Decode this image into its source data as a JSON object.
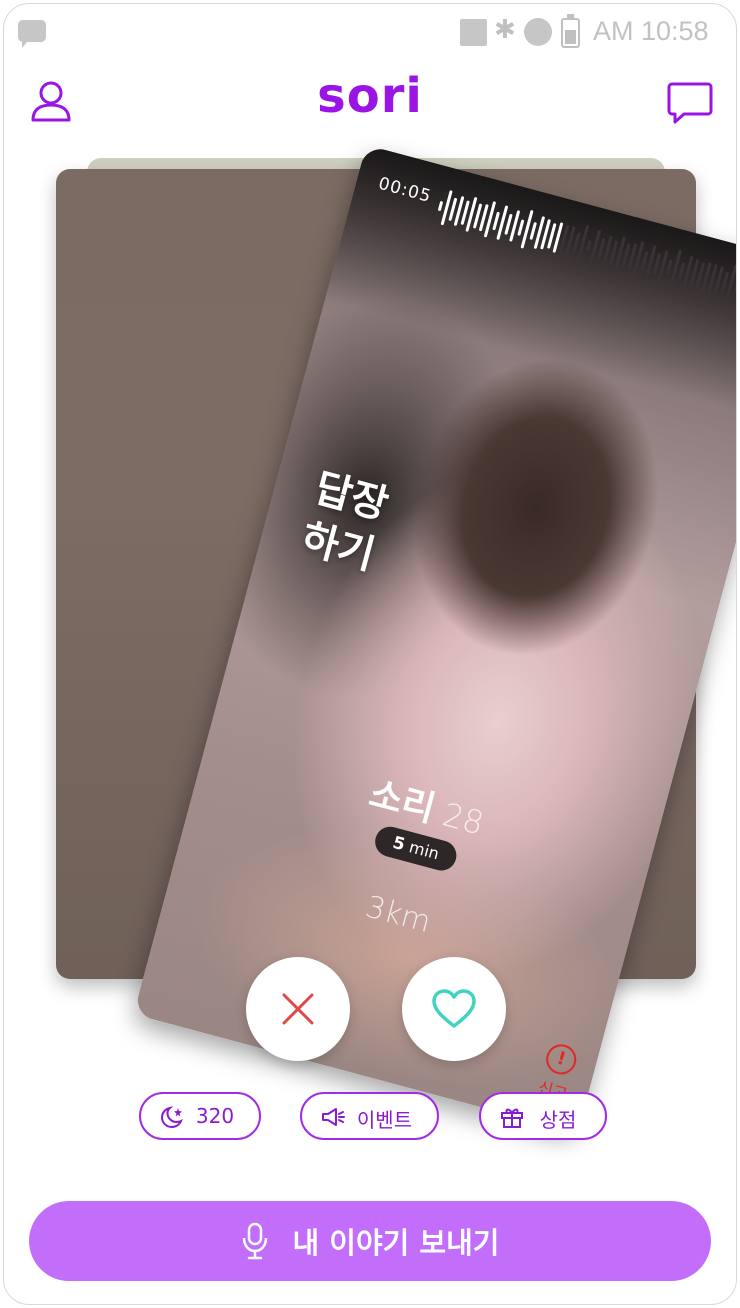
{
  "status_bar": {
    "time": "AM 10:58",
    "icons": [
      "chat-notification-icon",
      "square-icon",
      "bluetooth-icon",
      "circle-icon",
      "battery-icon"
    ]
  },
  "header": {
    "brand": "sori",
    "profile_icon": "user-icon",
    "message_icon": "chat-bubble-icon"
  },
  "card": {
    "audio_time": "00:05",
    "reply_label_line1": "답장",
    "reply_label_line2": "하기",
    "name": "소리",
    "age": "28",
    "duration_value": "5",
    "duration_unit": "min",
    "distance": "3km",
    "report_label": "신고",
    "report_icon": "exclamation-circle-icon"
  },
  "actions": {
    "pass_icon": "close-icon",
    "like_icon": "heart-icon"
  },
  "chips": {
    "points_value": "320",
    "points_icon": "moon-star-icon",
    "event_label": "이벤트",
    "event_icon": "megaphone-icon",
    "shop_label": "상점",
    "shop_icon": "gift-icon"
  },
  "cta": {
    "label": "내 이야기 보내기",
    "icon": "microphone-icon"
  },
  "colors": {
    "brand": "#9a14e6",
    "cta": "#c26efa",
    "chip_border": "#a22ce6",
    "pass": "#e24848",
    "like": "#3fd3c0",
    "report": "#e02828"
  }
}
